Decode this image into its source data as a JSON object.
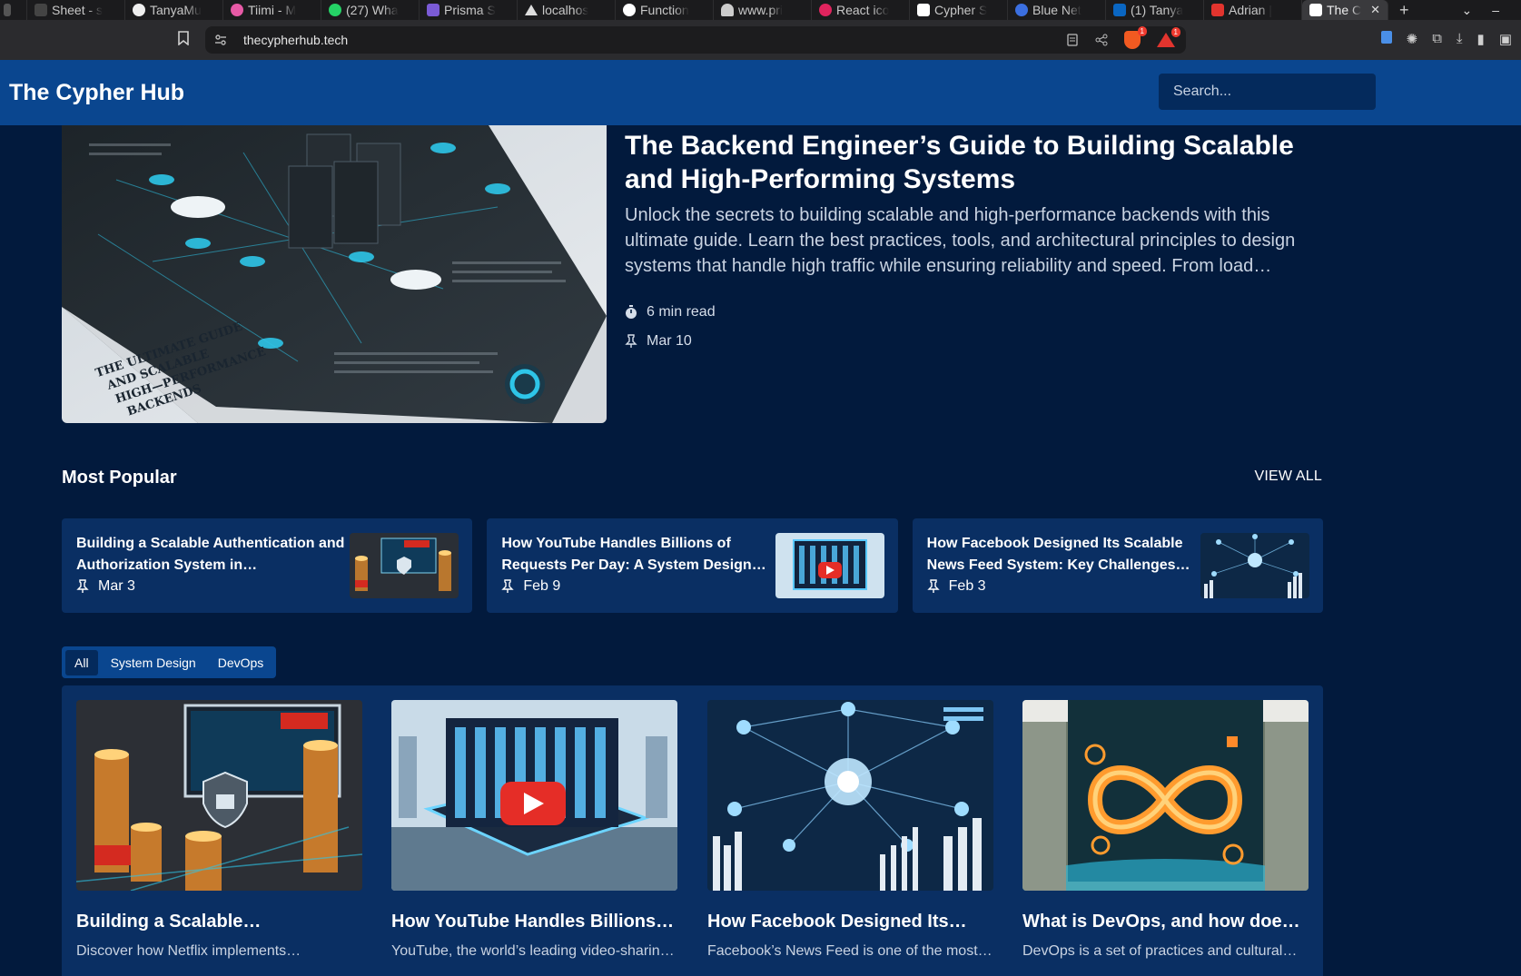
{
  "browser": {
    "tabs": [
      {
        "label": "Sheet - s",
        "color": "#444444"
      },
      {
        "label": "TanyaMu",
        "color": "#eeeeee"
      },
      {
        "label": "Tiimi - M",
        "color": "#e75aa6"
      },
      {
        "label": "(27) Wha",
        "color": "#25d366"
      },
      {
        "label": "Prisma S",
        "color": "#7b5bd6"
      },
      {
        "label": "localhos",
        "color": "#dddddd"
      },
      {
        "label": "Function",
        "color": "#ffffff"
      },
      {
        "label": "www.pri",
        "color": "#cccccc"
      },
      {
        "label": "React ico",
        "color": "#e0245e"
      },
      {
        "label": "Cypher S",
        "color": "#ffffff"
      },
      {
        "label": "Blue Net",
        "color": "#3b6fe0"
      },
      {
        "label": "(1) Tanya",
        "color": "#0a66c2"
      },
      {
        "label": "Adrian |",
        "color": "#e2342e"
      }
    ],
    "active_tab": {
      "label": "The C",
      "close": "✕"
    },
    "new_tab": "+",
    "url": "thecypherhub.tech",
    "shields_badge": "1",
    "rewards_badge": "1"
  },
  "site": {
    "logo": "The Cypher Hub",
    "search_placeholder": "Search..."
  },
  "hero": {
    "title": "The Backend Engineer’s Guide to Building Scalable and High-Performing Systems",
    "excerpt": "Unlock the secrets to building scalable and high-performance backends with this ultimate guide. Learn the best practices, tools, and architectural principles to design systems that handle high traffic while ensuring reliability and speed. From load…",
    "read_time": "6 min read",
    "date": "Mar 10",
    "image_caption": "THE ULTIMATE GUIDE AND SCALABLE HIGH-PERFORMANCE BACKENDS"
  },
  "popular": {
    "title": "Most Popular",
    "view_all": "VIEW ALL",
    "items": [
      {
        "title": "Building a Scalable Authentication and Authorization System in…",
        "date": "Mar 3"
      },
      {
        "title": "How YouTube Handles Billions of Requests Per Day: A System Design…",
        "date": "Feb 9"
      },
      {
        "title": "How Facebook Designed Its Scalable News Feed System: Key Challenges…",
        "date": "Feb 3"
      }
    ]
  },
  "filters": [
    "All",
    "System Design",
    "DevOps"
  ],
  "articles": [
    {
      "title": "Building a Scalable…",
      "excerpt": "Discover how Netflix implements…"
    },
    {
      "title": "How YouTube Handles Billions…",
      "excerpt": "YouTube, the world’s leading video-sharin…"
    },
    {
      "title": "How Facebook Designed Its…",
      "excerpt": "Facebook’s News Feed is one of the most…"
    },
    {
      "title": "What is DevOps, and how doe…",
      "excerpt": "DevOps is a set of practices and cultural…"
    }
  ],
  "colors": {
    "page_bg": "#021a3d",
    "header_bg": "#0a468f",
    "card_bg": "#0a2f63",
    "accent_cyan": "#2ec5e8"
  }
}
